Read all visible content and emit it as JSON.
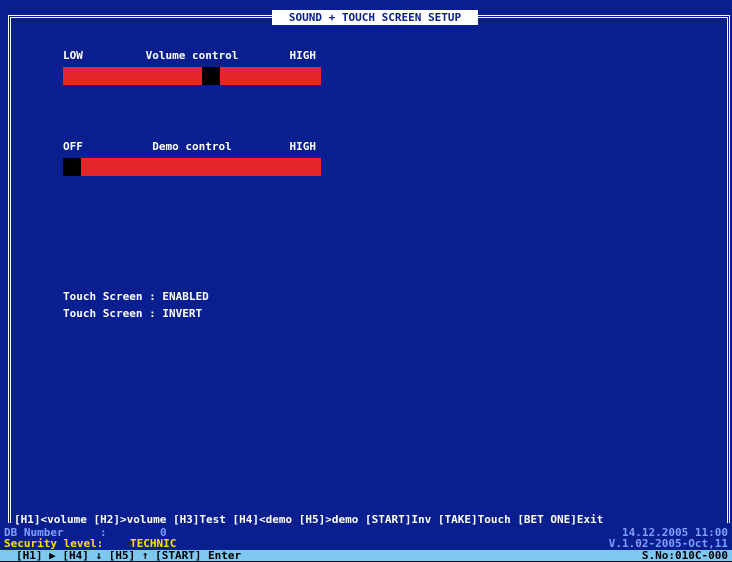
{
  "window": {
    "title": "SOUND + TOUCH SCREEN SETUP"
  },
  "volume": {
    "low_label": "LOW",
    "title": "Volume control",
    "high_label": "HIGH",
    "level_fraction": 0.58
  },
  "demo": {
    "low_label": "OFF",
    "title": "Demo control",
    "high_label": "HIGH",
    "level_fraction": 0.0
  },
  "touch": {
    "line1": "Touch Screen : ENABLED",
    "line2": "Touch Screen : INVERT"
  },
  "hotkeys": "[H1]<volume [H2]>volume [H3]Test [H4]<demo [H5]>demo [START]Inv [TAKE]Touch [BET ONE]Exit",
  "status": {
    "db_label": "DB Number",
    "db_colon": ":",
    "db_value": "0",
    "security_label": "Security level:",
    "security_value": "TECHNIC",
    "datetime": "14.12.2005   11:00",
    "version": "V.1.02-2005-Oct,11",
    "keys": "[H1] ▶  [H4] ↓  [H5] ↑  [START] Enter",
    "serial": "S.No:010C-000"
  },
  "colors": {
    "background": "#0a1f8f",
    "slider": "#e5262a",
    "thumb": "#000000",
    "security": "#ffe000"
  }
}
